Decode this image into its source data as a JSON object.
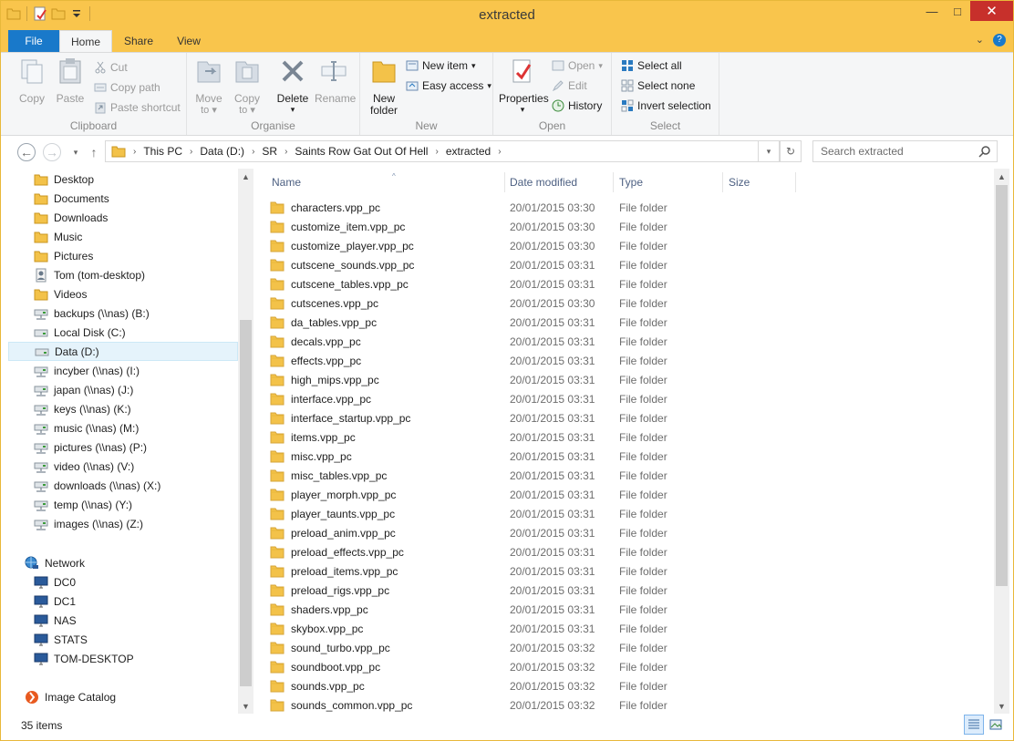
{
  "window": {
    "title": "extracted",
    "controls": {
      "minimize": "—",
      "maximize": "□",
      "close": "✕"
    }
  },
  "ribbon_tabs": [
    {
      "label": "File"
    },
    {
      "label": "Home"
    },
    {
      "label": "Share"
    },
    {
      "label": "View"
    }
  ],
  "ribbon": {
    "clipboard": {
      "label": "Clipboard",
      "copy": "Copy",
      "paste": "Paste",
      "cut": "Cut",
      "copy_path": "Copy path",
      "paste_shortcut": "Paste shortcut"
    },
    "organise": {
      "label": "Organise",
      "move_to_line1": "Move",
      "move_to_line2": "to",
      "copy_to_line1": "Copy",
      "copy_to_line2": "to",
      "delete": "Delete",
      "rename": "Rename"
    },
    "new": {
      "label": "New",
      "new_folder_line1": "New",
      "new_folder_line2": "folder",
      "new_item": "New item",
      "easy_access": "Easy access"
    },
    "open": {
      "label": "Open",
      "properties": "Properties",
      "open": "Open",
      "edit": "Edit",
      "history": "History"
    },
    "select": {
      "label": "Select",
      "select_all": "Select all",
      "select_none": "Select none",
      "invert_selection": "Invert selection"
    }
  },
  "address": {
    "breadcrumbs": [
      "This PC",
      "Data (D:)",
      "SR",
      "Saints Row Gat Out Of Hell",
      "extracted"
    ],
    "search_placeholder": "Search extracted"
  },
  "nav": {
    "favorites": [
      {
        "label": "Desktop",
        "icon": "desktop-folder-icon"
      },
      {
        "label": "Documents",
        "icon": "documents-folder-icon"
      },
      {
        "label": "Downloads",
        "icon": "downloads-folder-icon"
      },
      {
        "label": "Music",
        "icon": "music-folder-icon"
      },
      {
        "label": "Pictures",
        "icon": "pictures-folder-icon"
      },
      {
        "label": "Tom (tom-desktop)",
        "icon": "user-folder-icon"
      },
      {
        "label": "Videos",
        "icon": "videos-folder-icon"
      },
      {
        "label": "backups (\\\\nas) (B:)",
        "icon": "network-drive-icon"
      },
      {
        "label": "Local Disk (C:)",
        "icon": "local-disk-icon"
      },
      {
        "label": "Data (D:)",
        "icon": "local-disk-icon",
        "selected": true
      },
      {
        "label": "incyber (\\\\nas) (I:)",
        "icon": "network-drive-icon"
      },
      {
        "label": "japan (\\\\nas) (J:)",
        "icon": "network-drive-icon"
      },
      {
        "label": "keys (\\\\nas) (K:)",
        "icon": "network-drive-icon"
      },
      {
        "label": "music (\\\\nas) (M:)",
        "icon": "network-drive-icon"
      },
      {
        "label": "pictures (\\\\nas) (P:)",
        "icon": "network-drive-icon"
      },
      {
        "label": "video (\\\\nas) (V:)",
        "icon": "network-drive-icon"
      },
      {
        "label": "downloads (\\\\nas) (X:)",
        "icon": "network-drive-icon"
      },
      {
        "label": "temp (\\\\nas) (Y:)",
        "icon": "network-drive-icon"
      },
      {
        "label": "images (\\\\nas) (Z:)",
        "icon": "network-drive-icon"
      }
    ],
    "network_label": "Network",
    "network": [
      {
        "label": "DC0"
      },
      {
        "label": "DC1"
      },
      {
        "label": "NAS"
      },
      {
        "label": "STATS"
      },
      {
        "label": "TOM-DESKTOP"
      }
    ],
    "image_catalog": "Image Catalog"
  },
  "columns": {
    "name": "Name",
    "date": "Date modified",
    "type": "Type",
    "size": "Size"
  },
  "files": [
    {
      "name": "characters.vpp_pc",
      "date": "20/01/2015 03:30",
      "type": "File folder"
    },
    {
      "name": "customize_item.vpp_pc",
      "date": "20/01/2015 03:30",
      "type": "File folder"
    },
    {
      "name": "customize_player.vpp_pc",
      "date": "20/01/2015 03:30",
      "type": "File folder"
    },
    {
      "name": "cutscene_sounds.vpp_pc",
      "date": "20/01/2015 03:31",
      "type": "File folder"
    },
    {
      "name": "cutscene_tables.vpp_pc",
      "date": "20/01/2015 03:31",
      "type": "File folder"
    },
    {
      "name": "cutscenes.vpp_pc",
      "date": "20/01/2015 03:30",
      "type": "File folder"
    },
    {
      "name": "da_tables.vpp_pc",
      "date": "20/01/2015 03:31",
      "type": "File folder"
    },
    {
      "name": "decals.vpp_pc",
      "date": "20/01/2015 03:31",
      "type": "File folder"
    },
    {
      "name": "effects.vpp_pc",
      "date": "20/01/2015 03:31",
      "type": "File folder"
    },
    {
      "name": "high_mips.vpp_pc",
      "date": "20/01/2015 03:31",
      "type": "File folder"
    },
    {
      "name": "interface.vpp_pc",
      "date": "20/01/2015 03:31",
      "type": "File folder"
    },
    {
      "name": "interface_startup.vpp_pc",
      "date": "20/01/2015 03:31",
      "type": "File folder"
    },
    {
      "name": "items.vpp_pc",
      "date": "20/01/2015 03:31",
      "type": "File folder"
    },
    {
      "name": "misc.vpp_pc",
      "date": "20/01/2015 03:31",
      "type": "File folder"
    },
    {
      "name": "misc_tables.vpp_pc",
      "date": "20/01/2015 03:31",
      "type": "File folder"
    },
    {
      "name": "player_morph.vpp_pc",
      "date": "20/01/2015 03:31",
      "type": "File folder"
    },
    {
      "name": "player_taunts.vpp_pc",
      "date": "20/01/2015 03:31",
      "type": "File folder"
    },
    {
      "name": "preload_anim.vpp_pc",
      "date": "20/01/2015 03:31",
      "type": "File folder"
    },
    {
      "name": "preload_effects.vpp_pc",
      "date": "20/01/2015 03:31",
      "type": "File folder"
    },
    {
      "name": "preload_items.vpp_pc",
      "date": "20/01/2015 03:31",
      "type": "File folder"
    },
    {
      "name": "preload_rigs.vpp_pc",
      "date": "20/01/2015 03:31",
      "type": "File folder"
    },
    {
      "name": "shaders.vpp_pc",
      "date": "20/01/2015 03:31",
      "type": "File folder"
    },
    {
      "name": "skybox.vpp_pc",
      "date": "20/01/2015 03:31",
      "type": "File folder"
    },
    {
      "name": "sound_turbo.vpp_pc",
      "date": "20/01/2015 03:32",
      "type": "File folder"
    },
    {
      "name": "soundboot.vpp_pc",
      "date": "20/01/2015 03:32",
      "type": "File folder"
    },
    {
      "name": "sounds.vpp_pc",
      "date": "20/01/2015 03:32",
      "type": "File folder"
    },
    {
      "name": "sounds_common.vpp_pc",
      "date": "20/01/2015 03:32",
      "type": "File folder"
    }
  ],
  "status": {
    "item_count": "35 items"
  },
  "colors": {
    "titlebar": "#f9c54c",
    "file_tab": "#1979ca",
    "folder": "#f3c249",
    "selection": "#e5f3fb"
  }
}
